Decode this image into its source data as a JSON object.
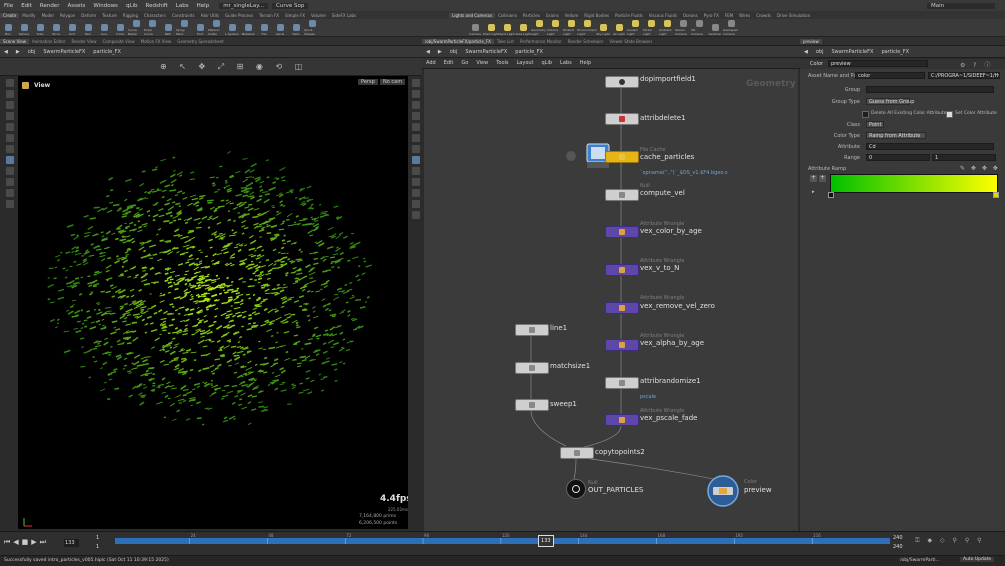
{
  "menu": [
    "File",
    "Edit",
    "Render",
    "Assets",
    "Windows",
    "qLib",
    "Redshift",
    "Labs",
    "Help"
  ],
  "desktop": {
    "scene_file": "mr_singleLay...",
    "curve_tab": "Curve Sop",
    "desktop_name": "Main"
  },
  "shelf_tabs_left": [
    "Create",
    "Modify",
    "Model",
    "Polygon",
    "Deform",
    "Texture",
    "Rigging",
    "Characters",
    "Constraints",
    "Hair Utils",
    "Guide Process",
    "Terrain FX",
    "Simple FX",
    "Volume",
    "SideFX Labs"
  ],
  "shelf_tabs_right": [
    "Lights and Cameras",
    "Collisions",
    "Particles",
    "Grains",
    "Vellum",
    "Rigid Bodies",
    "Particle Fluids",
    "Viscous Fluids",
    "Oceans",
    "Pyro FX",
    "FEM",
    "Wires",
    "Crowds",
    "Drive Simulation"
  ],
  "tools_left": [
    "Box",
    "Sphere",
    "Tube",
    "Torus",
    "Grid",
    "Null",
    "Line",
    "Circle",
    "Curve Bezier",
    "Draw Curve",
    "Path",
    "Spray Paint",
    "Font",
    "Platonic Solids",
    "L-System",
    "Metaball",
    "File",
    "Spiral",
    "Helix",
    "Quick Shapes"
  ],
  "tools_right": [
    "Camera",
    "Point Light",
    "Spot Light",
    "Area Light",
    "Geometry Light",
    "Volume Light",
    "Distant Light",
    "Environment Light",
    "Sky Light",
    "GI Light",
    "Caustic Light",
    "Portal Light",
    "Ambient Light",
    "Stereo Camera",
    "VR Camera",
    "Switcher",
    "Gamepad Camera"
  ],
  "left_pane": {
    "tabs": [
      "Scene View",
      "Animation Editor",
      "Render View",
      "Composite View",
      "Motion FX View",
      "Geometry Spreadsheet"
    ],
    "path": [
      "obj",
      "SwarmParticleFX",
      "particle_FX"
    ],
    "view_label": "View",
    "persp": "Persp",
    "camera": "No cam",
    "fps": "4.4fps",
    "ms": "225.02ms",
    "prims_line": "7,164,800  prims",
    "points_line": "6,206,500  points"
  },
  "net_pane": {
    "tabs": [
      "/obj/SwarmParticleFX/particle_FX",
      "Take List",
      "Performance Monitor",
      "Render Scheduler",
      "Viewer State Browser"
    ],
    "path": [
      "obj",
      "SwarmParticleFX",
      "particle_FX"
    ],
    "menu": [
      "Add",
      "Edit",
      "Go",
      "View",
      "Tools",
      "Layout",
      "qLib",
      "Labs",
      "Help"
    ],
    "context_label": "Geometry",
    "nodes": {
      "dopimportfield1": "dopimportfield1",
      "attribdelete1": "attribdelete1",
      "cache_type": "File Cache",
      "cache_particles": "cache_particles",
      "cache_path": "`opname(\"..\")`_$OS_v1.$F4.bgeo.s",
      "null_type": "Null",
      "compute_vel": "compute_vel",
      "wrangle_type": "Attribute Wrangle",
      "vex_color_by_age": "vex_color_by_age",
      "vex_v_to_N": "vex_v_to_N",
      "vex_remove_vel_zero": "vex_remove_vel_zero",
      "vex_alpha_by_age": "vex_alpha_by_age",
      "attribrandomize1": "attribrandomize1",
      "attribrandomize_note": "pscale",
      "vex_pscale_fade": "vex_pscale_fade",
      "line1": "line1",
      "matchsize1": "matchsize1",
      "sweep1": "sweep1",
      "copytopoints2": "copytopoints2",
      "out_type": "Null",
      "out_particles": "OUT_PARTICLES",
      "color_type": "Color",
      "preview": "preview"
    }
  },
  "param_pane": {
    "tab": "preview",
    "path": [
      "obj",
      "SwarmParticleFX",
      "particle_FX"
    ],
    "node_type": "Color",
    "node_name": "preview",
    "asset_label": "Asset Name and Path",
    "asset_name": "color",
    "asset_path": "C:/PROGRA~1/SIDEEF~1/HOU...",
    "group_label": "Group",
    "group_value": "",
    "group_type_label": "Group Type",
    "group_type_value": "Guess from Group",
    "delete_attrs_label": "Delete All Existing Color Attributes",
    "set_color_label": "Set Color Attribute",
    "class_label": "Class",
    "class_value": "Point",
    "color_type_label": "Color Type",
    "color_type_value": "Ramp from Attribute",
    "attribute_label": "Attribute",
    "attribute_value": "Cd",
    "range_label": "Range",
    "range_min": "0",
    "range_max": "1",
    "ramp_label": "Attribute Ramp",
    "ramp_colors": [
      "#00c000",
      "#ffff00"
    ]
  },
  "timeline": {
    "current_frame": "133",
    "start": "1",
    "start2": "1",
    "end": "240",
    "end2": "240",
    "marker": "133",
    "ticks": [
      "24",
      "48",
      "72",
      "96",
      "120",
      "144",
      "168",
      "192",
      "216"
    ]
  },
  "status": {
    "message": "Successfully saved intro_particles_v005.hiplc (Sat Oct 11 10:39:15 2025)",
    "path": "/obj/SwarmParti...",
    "auto_update": "Auto Update"
  },
  "colors": {
    "node_purple": "#5d47a8",
    "node_yellow": "#e6b414",
    "particle": "#7fdc1c",
    "timeline_blue": "#2d6fb8"
  }
}
